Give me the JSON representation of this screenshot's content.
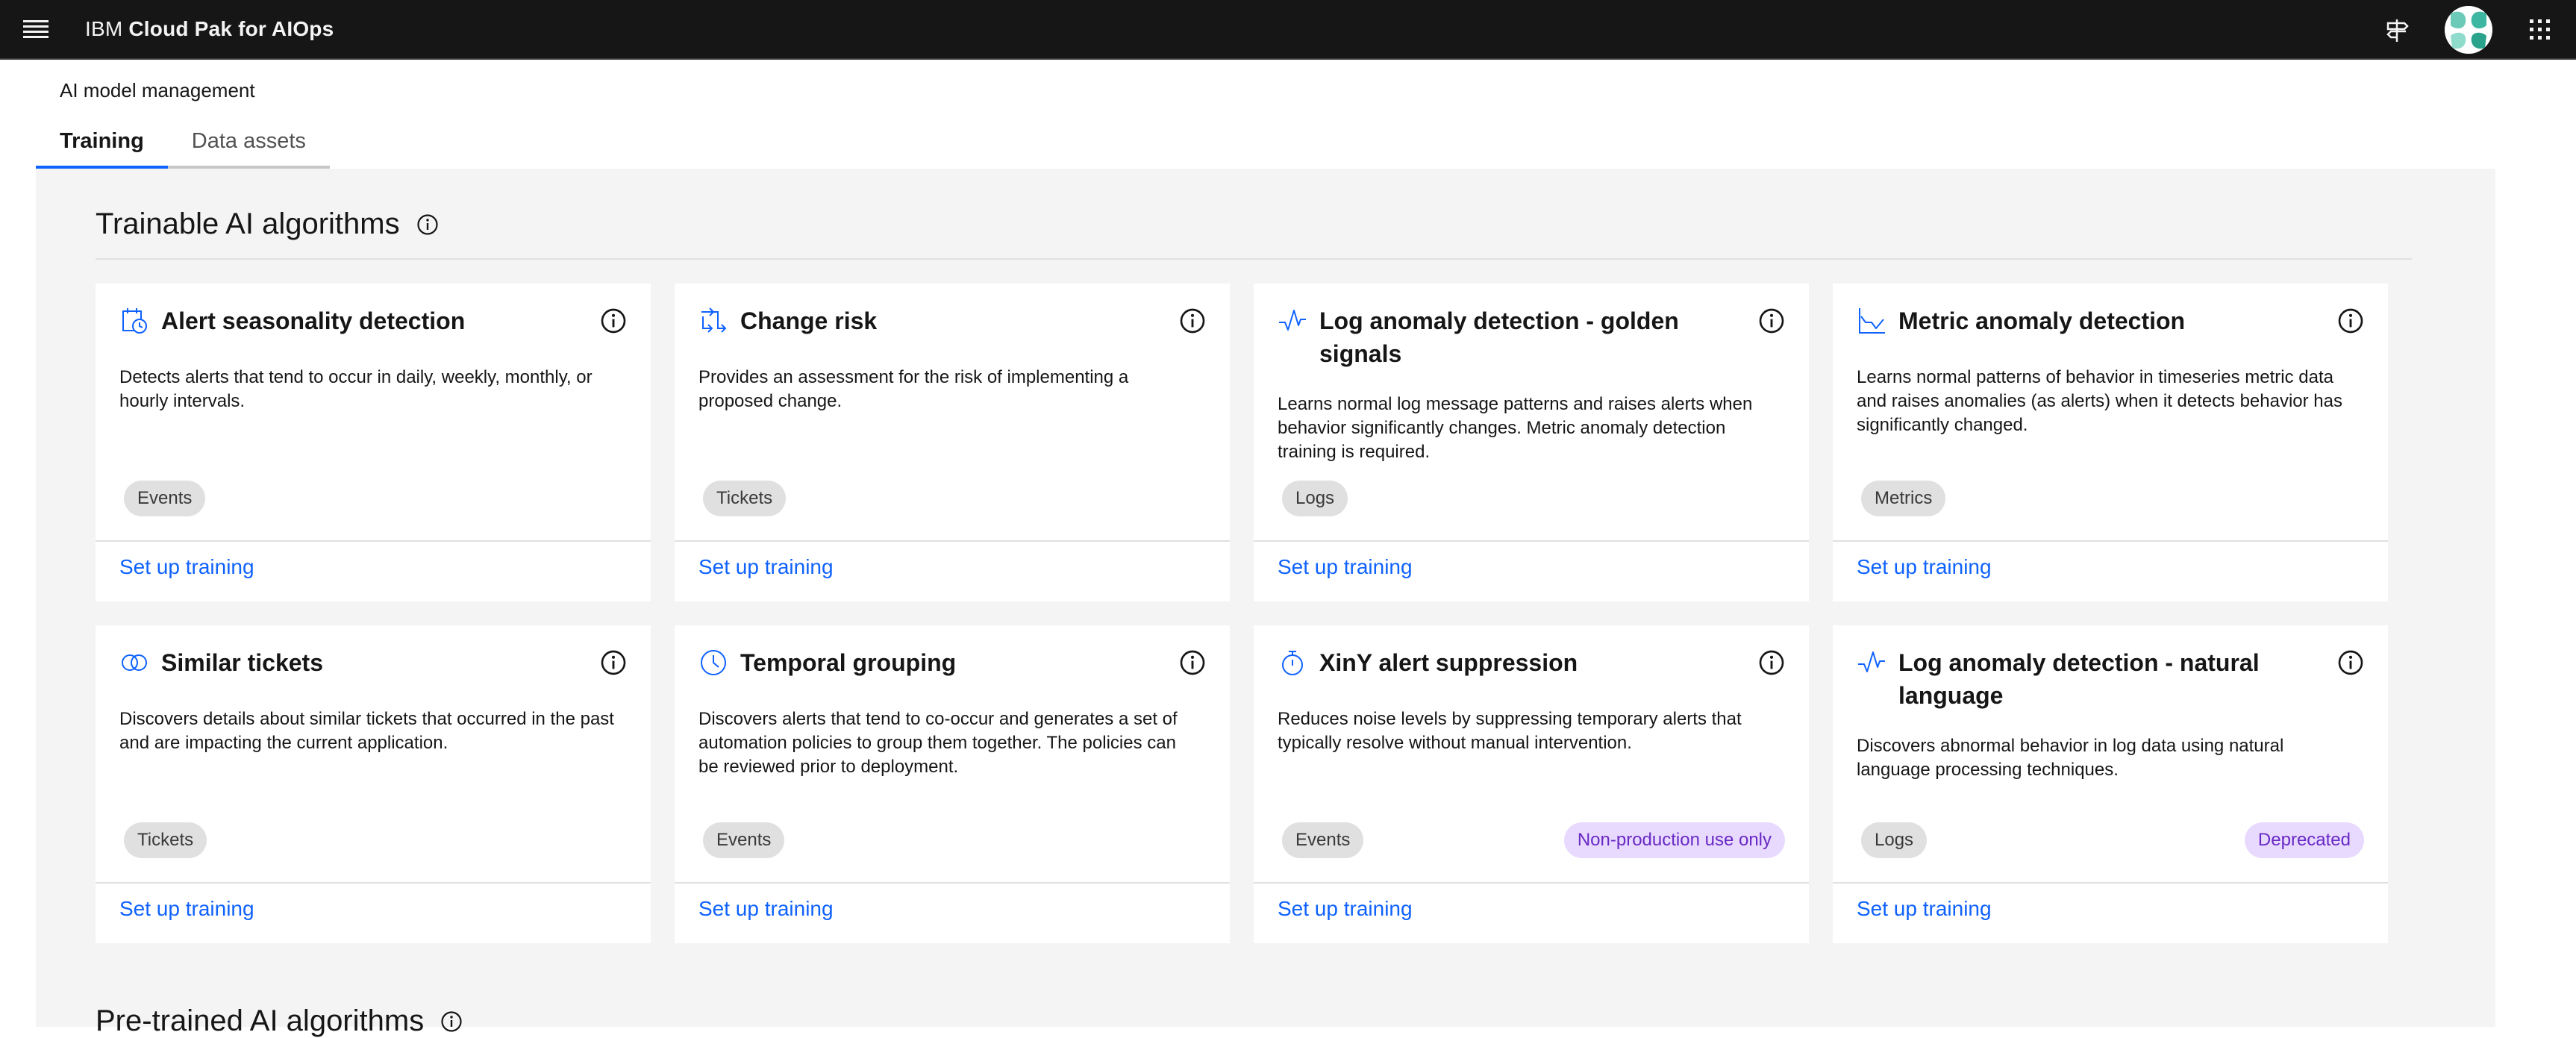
{
  "header": {
    "brand": "IBM",
    "product_name": "Cloud Pak for AIOps"
  },
  "page": {
    "label": "AI model management"
  },
  "tabs": [
    {
      "label": "Training",
      "active": true
    },
    {
      "label": "Data assets",
      "active": false
    }
  ],
  "sections": {
    "trainable_title": "Trainable AI algorithms",
    "pretrained_title": "Pre-trained AI algorithms"
  },
  "colors": {
    "accent": "#0f62fe",
    "header_bg": "#161616",
    "panel_bg": "#f4f4f4",
    "tag_bg": "#e0e0e0",
    "purple_tag_bg": "#e8daff",
    "purple_tag_text": "#6929c4"
  },
  "cards": [
    {
      "icon": "calendar-clock-icon",
      "title": "Alert seasonality detection",
      "description": "Detects alerts that tend to occur in daily, weekly, monthly, or hourly intervals.",
      "tag": "Events",
      "badge": "",
      "link": "Set up training"
    },
    {
      "icon": "change-arrows-icon",
      "title": "Change risk",
      "description": "Provides an assessment for the risk of implementing a proposed change.",
      "tag": "Tickets",
      "badge": "",
      "link": "Set up training"
    },
    {
      "icon": "activity-icon",
      "title": "Log anomaly detection - golden signals",
      "description": "Learns normal log message patterns and raises alerts when behavior significantly changes. Metric anomaly detection training is required.",
      "tag": "Logs",
      "badge": "",
      "link": "Set up training"
    },
    {
      "icon": "line-chart-icon",
      "title": "Metric anomaly detection",
      "description": "Learns normal patterns of behavior in timeseries metric data and raises anomalies (as alerts) when it detects behavior has significantly changed.",
      "tag": "Metrics",
      "badge": "",
      "link": "Set up training"
    },
    {
      "icon": "overlap-circles-icon",
      "title": "Similar tickets",
      "description": "Discovers details about similar tickets that occurred in the past and are impacting the current application.",
      "tag": "Tickets",
      "badge": "",
      "link": "Set up training"
    },
    {
      "icon": "clock-icon",
      "title": "Temporal grouping",
      "description": "Discovers alerts that tend to co-occur and generates a set of automation policies to group them together. The policies can be reviewed prior to deployment.",
      "tag": "Events",
      "badge": "",
      "link": "Set up training"
    },
    {
      "icon": "timer-icon",
      "title": "XinY alert suppression",
      "description": "Reduces noise levels by suppressing temporary alerts that typically resolve without manual intervention.",
      "tag": "Events",
      "badge": "Non-production use only",
      "link": "Set up training"
    },
    {
      "icon": "activity-icon",
      "title": "Log anomaly detection - natural language",
      "description": "Discovers abnormal behavior in log data using natural language processing techniques.",
      "tag": "Logs",
      "badge": "Deprecated",
      "link": "Set up training"
    }
  ]
}
